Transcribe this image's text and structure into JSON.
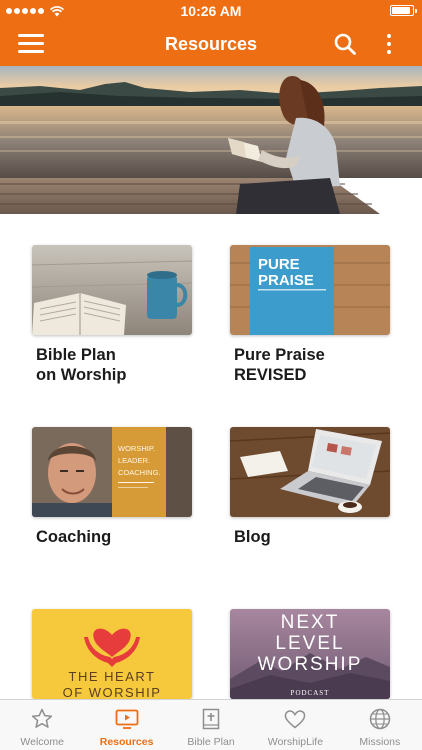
{
  "status_bar": {
    "time": "10:26 AM",
    "signal_bars": 5,
    "battery_level": 0.95
  },
  "nav": {
    "title": "Resources",
    "menu_icon": "hamburger-menu-icon",
    "search_icon": "search-icon",
    "more_icon": "more-vertical-icon"
  },
  "hero": {
    "image": "woman-reading-bible-on-lake-dock-at-sunset"
  },
  "resources": [
    {
      "title": "Bible Plan\non Worship",
      "image": "open-bible-and-mug"
    },
    {
      "title": "Pure Praise\nREVISED",
      "image": "pure-praise-book-cover",
      "cover_title": [
        "PURE",
        "PRAISE"
      ],
      "cover_subtitle": ""
    },
    {
      "title": "Coaching",
      "image": "coach-portrait",
      "banner_lines": [
        "WORSHIP.",
        "LEADER.",
        "COACHING."
      ]
    },
    {
      "title": "Blog",
      "image": "laptop-on-wooden-desk"
    },
    {
      "title": "",
      "image": "heart-in-hands",
      "overlay": [
        "THE HEART",
        "OF WORSHIP"
      ]
    },
    {
      "title": "",
      "image": "mountain-range",
      "overlay": [
        "NEXT",
        "LEVEL",
        "WORSHIP"
      ],
      "tag": "PODCAST"
    }
  ],
  "tabs": [
    {
      "label": "Welcome",
      "icon": "star-icon",
      "active": false
    },
    {
      "label": "Resources",
      "icon": "video-play-icon",
      "active": true
    },
    {
      "label": "Bible Plan",
      "icon": "bible-plus-icon",
      "active": false
    },
    {
      "label": "WorshipLife",
      "icon": "heart-outline-icon",
      "active": false
    },
    {
      "label": "Missions",
      "icon": "globe-icon",
      "active": false
    }
  ],
  "colors": {
    "accent": "#ee6f13",
    "tab_inactive": "#8e8e8e",
    "tab_bar_bg": "#f8f8f8"
  }
}
